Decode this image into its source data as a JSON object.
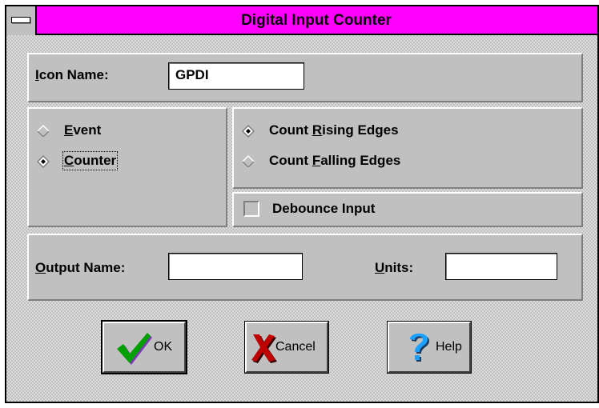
{
  "window": {
    "title": "Digital Input Counter"
  },
  "icon_name": {
    "label_u": "I",
    "label_rest": "con Name:",
    "value": "GPDI"
  },
  "mode": {
    "event": {
      "label_u": "E",
      "label_rest": "vent",
      "selected": false
    },
    "counter": {
      "label_u": "C",
      "label_rest": "ounter",
      "selected": true
    }
  },
  "edges": {
    "rising": {
      "label_pre": "Count ",
      "label_u": "R",
      "label_rest": "ising Edges",
      "selected": true
    },
    "falling": {
      "label_pre": "Count ",
      "label_u": "F",
      "label_rest": "alling Edges",
      "selected": false
    }
  },
  "debounce": {
    "label": "Debounce Input",
    "checked": false
  },
  "output": {
    "name_label_u": "O",
    "name_label_rest": "utput Name:",
    "name_value": "",
    "units_label_u": "U",
    "units_label_rest": "nits:",
    "units_value": ""
  },
  "buttons": {
    "ok": "OK",
    "cancel": "Cancel",
    "help": "Help"
  },
  "icons": {
    "ok": "checkmark-icon",
    "cancel": "red-x-icon",
    "help": "question-mark-icon",
    "system_menu": "system-menu-icon"
  },
  "colors": {
    "title_bar": "#ff00ff",
    "face": "#c0c0c0",
    "check_green": "#00a000",
    "x_red": "#c00000",
    "help_blue": "#0080ff"
  }
}
